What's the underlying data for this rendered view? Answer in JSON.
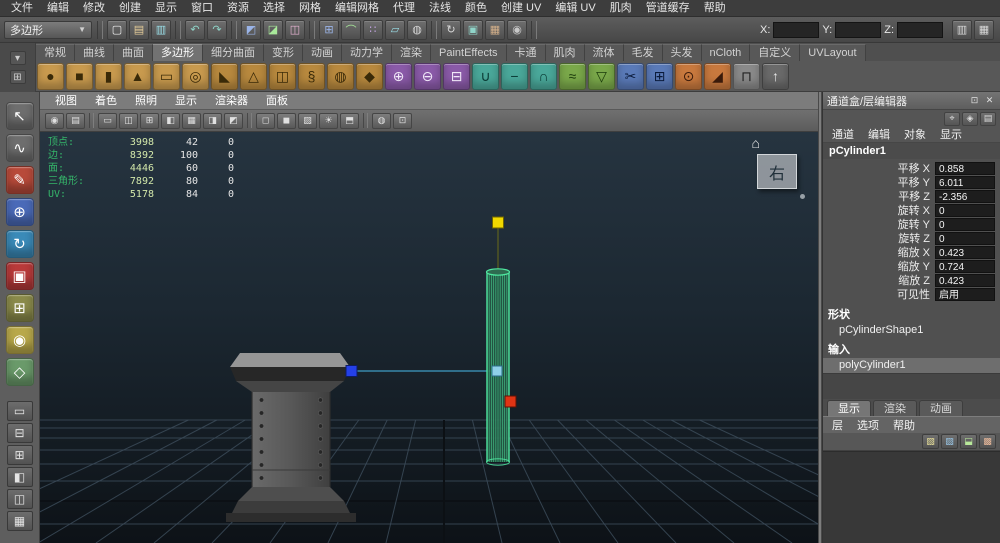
{
  "menubar": {
    "items": [
      "文件",
      "编辑",
      "修改",
      "创建",
      "显示",
      "窗口",
      "资源",
      "选择",
      "网格",
      "编辑网格",
      "代理",
      "法线",
      "颜色",
      "创建 UV",
      "编辑 UV",
      "肌肉",
      "管道缓存",
      "帮助"
    ]
  },
  "statusline": {
    "mode": "多边形",
    "dropdown_arrow": "▼",
    "icons": [
      {
        "kind": "sep",
        "name": "separator",
        "glyph": "",
        "fg": ""
      },
      {
        "kind": "btn",
        "name": "new-scene-icon",
        "glyph": "▢",
        "fg": "#f0f0f0"
      },
      {
        "kind": "btn",
        "name": "open-scene-icon",
        "glyph": "▤",
        "fg": "#e8cf9a"
      },
      {
        "kind": "btn",
        "name": "save-scene-icon",
        "glyph": "▥",
        "fg": "#9adfe8"
      },
      {
        "kind": "sep",
        "name": "separator",
        "glyph": "",
        "fg": ""
      },
      {
        "kind": "btn",
        "name": "undo-icon",
        "glyph": "↶",
        "fg": "#8fd4c8"
      },
      {
        "kind": "btn",
        "name": "redo-icon",
        "glyph": "↷",
        "fg": "#8fd4c8"
      },
      {
        "kind": "sep",
        "name": "separator",
        "glyph": "",
        "fg": ""
      },
      {
        "kind": "btn",
        "name": "select-hierarchy-mode-icon",
        "glyph": "◩",
        "fg": "#9ab4e8"
      },
      {
        "kind": "btn",
        "name": "select-object-mode-icon",
        "glyph": "◪",
        "fg": "#a8e89a"
      },
      {
        "kind": "btn",
        "name": "select-component-mode-icon",
        "glyph": "◫",
        "fg": "#e8b4d4"
      },
      {
        "kind": "sep",
        "name": "separator",
        "glyph": "",
        "fg": ""
      },
      {
        "kind": "btn",
        "name": "snap-to-grid-icon",
        "glyph": "⊞",
        "fg": "#9ab4e8"
      },
      {
        "kind": "btn",
        "name": "snap-to-curve-icon",
        "glyph": "⌒",
        "fg": "#a8e89a"
      },
      {
        "kind": "btn",
        "name": "snap-to-point-icon",
        "glyph": "∷",
        "fg": "#c8a8e8"
      },
      {
        "kind": "btn",
        "name": "snap-to-plane-icon",
        "glyph": "▱",
        "fg": "#9adfe8"
      },
      {
        "kind": "btn",
        "name": "make-live-icon",
        "glyph": "◍",
        "fg": "#d8d8d8"
      },
      {
        "kind": "sep",
        "name": "separator",
        "glyph": "",
        "fg": ""
      },
      {
        "kind": "btn",
        "name": "construction-history-icon",
        "glyph": "↻",
        "fg": "#d8d8d8"
      },
      {
        "kind": "btn",
        "name": "render-current-frame-icon",
        "glyph": "▣",
        "fg": "#8fd4c8"
      },
      {
        "kind": "btn",
        "name": "ipr-render-icon",
        "glyph": "▦",
        "fg": "#d4b08a"
      },
      {
        "kind": "btn",
        "name": "render-settings-icon",
        "glyph": "◉",
        "fg": "#c8c8c8"
      },
      {
        "kind": "sep",
        "name": "separator",
        "glyph": "",
        "fg": ""
      }
    ],
    "coords": {
      "x_label": "X:",
      "y_label": "Y:",
      "z_label": "Z:",
      "x_value": "",
      "y_value": "",
      "z_value": ""
    },
    "right_icons": [
      {
        "kind": "btn",
        "name": "toggle-channel-box-icon",
        "glyph": "▥",
        "fg": "#d8d8d8"
      },
      {
        "kind": "btn",
        "name": "toggle-tool-settings-icon",
        "glyph": "▦",
        "fg": "#d8d8d8"
      }
    ]
  },
  "shelf": {
    "side_icons": [
      {
        "name": "shelf-tab-menu-icon",
        "glyph": "▾"
      },
      {
        "name": "shelf-options-icon",
        "glyph": "⊞"
      }
    ],
    "tabs": [
      "常规",
      "曲线",
      "曲面",
      "多边形",
      "细分曲面",
      "变形",
      "动画",
      "动力学",
      "渲染",
      "PaintEffects",
      "卡通",
      "肌肉",
      "流体",
      "毛发",
      "头发",
      "nCloth",
      "自定义",
      "UVLayout"
    ],
    "active_tab": "多边形",
    "icons": [
      {
        "name": "poly-sphere-icon",
        "glyph": "●",
        "bg": "#c89a4e",
        "fg": "#3a2a08"
      },
      {
        "name": "poly-cube-icon",
        "glyph": "■",
        "bg": "#c89a4e",
        "fg": "#3a2a08"
      },
      {
        "name": "poly-cylinder-icon",
        "glyph": "▮",
        "bg": "#c89a4e",
        "fg": "#3a2a08"
      },
      {
        "name": "poly-cone-icon",
        "glyph": "▲",
        "bg": "#c89a4e",
        "fg": "#3a2a08"
      },
      {
        "name": "poly-plane-icon",
        "glyph": "▭",
        "bg": "#c89a4e",
        "fg": "#3a2a08"
      },
      {
        "name": "poly-torus-icon",
        "glyph": "◎",
        "bg": "#c89a4e",
        "fg": "#3a2a08"
      },
      {
        "name": "poly-prism-icon",
        "glyph": "◣",
        "bg": "#b8893e",
        "fg": "#3a2a08"
      },
      {
        "name": "poly-pyramid-icon",
        "glyph": "△",
        "bg": "#b8893e",
        "fg": "#3a2a08"
      },
      {
        "name": "poly-pipe-icon",
        "glyph": "◫",
        "bg": "#b8893e",
        "fg": "#3a2a08"
      },
      {
        "name": "poly-helix-icon",
        "glyph": "§",
        "bg": "#b8893e",
        "fg": "#3a2a08"
      },
      {
        "name": "poly-soccer-ball-icon",
        "glyph": "◍",
        "bg": "#b8893e",
        "fg": "#3a2a08"
      },
      {
        "name": "poly-platonic-icon",
        "glyph": "◆",
        "bg": "#b8893e",
        "fg": "#3a2a08"
      },
      {
        "name": "combine-icon",
        "glyph": "⊕",
        "bg": "#8a5aa8",
        "fg": "#f0e8f8"
      },
      {
        "name": "separate-icon",
        "glyph": "⊖",
        "bg": "#8a5aa8",
        "fg": "#f0e8f8"
      },
      {
        "name": "extract-icon",
        "glyph": "⊟",
        "bg": "#8a5aa8",
        "fg": "#f0e8f8"
      },
      {
        "name": "boolean-union-icon",
        "glyph": "∪",
        "bg": "#4aa89a",
        "fg": "#0a3a34"
      },
      {
        "name": "boolean-difference-icon",
        "glyph": "−",
        "bg": "#4aa89a",
        "fg": "#0a3a34"
      },
      {
        "name": "boolean-intersection-icon",
        "glyph": "∩",
        "bg": "#4aa89a",
        "fg": "#0a3a34"
      },
      {
        "name": "smooth-icon",
        "glyph": "≈",
        "bg": "#7aa84a",
        "fg": "#1a3a0a"
      },
      {
        "name": "reduce-icon",
        "glyph": "▽",
        "bg": "#7aa84a",
        "fg": "#1a3a0a"
      },
      {
        "name": "split-polygon-tool-icon",
        "glyph": "✂",
        "bg": "#5a7ab8",
        "fg": "#0a1a3a"
      },
      {
        "name": "append-polygon-icon",
        "glyph": "⊞",
        "bg": "#5a7ab8",
        "fg": "#0a1a3a"
      },
      {
        "name": "merge-vertices-icon",
        "glyph": "⊙",
        "bg": "#c8793e",
        "fg": "#3a1a0a"
      },
      {
        "name": "bevel-icon",
        "glyph": "◢",
        "bg": "#c8793e",
        "fg": "#3a1a0a"
      },
      {
        "name": "bridge-icon",
        "glyph": "⊓",
        "bg": "#8a8a8a",
        "fg": "#222222"
      },
      {
        "name": "extrude-icon",
        "glyph": "↑",
        "bg": "#6a6a6a",
        "fg": "#e8e8e8"
      }
    ]
  },
  "toolbox": {
    "tools": [
      {
        "name": "select-tool-icon",
        "glyph": "↖",
        "bg": "#6e6e6e",
        "fg": "#ffffff"
      },
      {
        "name": "lasso-tool-icon",
        "glyph": "∿",
        "bg": "#6e6e6e",
        "fg": "#ffffff"
      },
      {
        "name": "paint-select-tool-icon",
        "glyph": "✎",
        "bg": "#b84a3a",
        "fg": "#ffffff"
      },
      {
        "name": "move-tool-icon",
        "glyph": "⊕",
        "bg": "#4a6ab8",
        "fg": "#ffffff"
      },
      {
        "name": "rotate-tool-icon",
        "glyph": "↻",
        "bg": "#3a8ab8",
        "fg": "#ffffff"
      },
      {
        "name": "scale-tool-icon",
        "glyph": "▣",
        "bg": "#b83a3a",
        "fg": "#ffffff"
      },
      {
        "name": "universal-manipulator-icon",
        "glyph": "⊞",
        "bg": "#8a8a4a",
        "fg": "#ffffff"
      },
      {
        "name": "soft-modification-icon",
        "glyph": "◉",
        "bg": "#b8a84a",
        "fg": "#ffffff"
      },
      {
        "name": "show-manipulator-icon",
        "glyph": "◇",
        "bg": "#6a9a6a",
        "fg": "#ffffff"
      }
    ],
    "layouts": [
      {
        "name": "layout-single-pane-icon",
        "glyph": "▭"
      },
      {
        "name": "layout-two-pane-icon",
        "glyph": "⊟"
      },
      {
        "name": "layout-four-pane-icon",
        "glyph": "⊞"
      },
      {
        "name": "layout-outliner-persp-icon",
        "glyph": "◧"
      },
      {
        "name": "layout-split-vertical-icon",
        "glyph": "◫"
      },
      {
        "name": "layout-hypergraph-icon",
        "glyph": "▦"
      }
    ]
  },
  "viewport": {
    "menus": [
      "视图",
      "着色",
      "照明",
      "显示",
      "渲染器",
      "面板"
    ],
    "toolbar_icons": [
      {
        "kind": "btn",
        "name": "camera-attributes-icon",
        "glyph": "◉",
        "fg": ""
      },
      {
        "kind": "btn",
        "name": "bookmark-icon",
        "glyph": "▤",
        "fg": ""
      },
      {
        "kind": "sep",
        "name": "separator",
        "glyph": "",
        "fg": ""
      },
      {
        "kind": "btn",
        "name": "image-plane-icon",
        "glyph": "▭",
        "fg": ""
      },
      {
        "kind": "btn",
        "name": "film-gate-icon",
        "glyph": "◫",
        "fg": ""
      },
      {
        "kind": "btn",
        "name": "resolution-gate-icon",
        "glyph": "⊞",
        "fg": ""
      },
      {
        "kind": "btn",
        "name": "gate-mask-icon",
        "glyph": "◧",
        "fg": ""
      },
      {
        "kind": "btn",
        "name": "field-chart-icon",
        "glyph": "▦",
        "fg": ""
      },
      {
        "kind": "btn",
        "name": "safe-action-icon",
        "glyph": "◨",
        "fg": ""
      },
      {
        "kind": "btn",
        "name": "safe-title-icon",
        "glyph": "◩",
        "fg": ""
      },
      {
        "kind": "sep",
        "name": "separator",
        "glyph": "",
        "fg": ""
      },
      {
        "kind": "btn",
        "name": "wireframe-mode-icon",
        "glyph": "◻",
        "fg": ""
      },
      {
        "kind": "btn",
        "name": "shaded-mode-icon",
        "glyph": "◼",
        "fg": ""
      },
      {
        "kind": "btn",
        "name": "textured-mode-icon",
        "glyph": "▨",
        "fg": ""
      },
      {
        "kind": "btn",
        "name": "lights-toggle-icon",
        "glyph": "☀",
        "fg": ""
      },
      {
        "kind": "btn",
        "name": "shadows-toggle-icon",
        "glyph": "⬒",
        "fg": ""
      },
      {
        "kind": "sep",
        "name": "separator",
        "glyph": "",
        "fg": ""
      },
      {
        "kind": "btn",
        "name": "xray-mode-icon",
        "glyph": "◍",
        "fg": ""
      },
      {
        "kind": "btn",
        "name": "isolate-select-icon",
        "glyph": "⊡",
        "fg": ""
      }
    ],
    "hud": {
      "rows": [
        {
          "label": "顶点:",
          "v1": "3998",
          "v2": "42",
          "v3": "0"
        },
        {
          "label": "边:",
          "v1": "8392",
          "v2": "100",
          "v3": "0"
        },
        {
          "label": "面:",
          "v1": "4446",
          "v2": "60",
          "v3": "0"
        },
        {
          "label": "三角形:",
          "v1": "7892",
          "v2": "80",
          "v3": "0"
        },
        {
          "label": "UV:",
          "v1": "5178",
          "v2": "84",
          "v3": "0"
        }
      ]
    },
    "view_label": "右",
    "home_icon": "⌂"
  },
  "channelbox": {
    "title": "通道盒/层编辑器",
    "title_icons": [
      {
        "name": "panel-pin-icon",
        "glyph": "⊡"
      },
      {
        "name": "panel-close-icon",
        "glyph": "✕"
      }
    ],
    "toolbar_icons": [
      {
        "name": "channel-manip-icon",
        "glyph": "⌖"
      },
      {
        "name": "channel-speed-icon",
        "glyph": "◈"
      },
      {
        "name": "channel-settings-icon",
        "glyph": "▤"
      }
    ],
    "menus": [
      "通道",
      "编辑",
      "对象",
      "显示"
    ],
    "object_name": "pCylinder1",
    "attributes": [
      {
        "label": "平移 X",
        "value": "0.858"
      },
      {
        "label": "平移 Y",
        "value": "6.011"
      },
      {
        "label": "平移 Z",
        "value": "-2.356"
      },
      {
        "label": "旋转 X",
        "value": "0"
      },
      {
        "label": "旋转 Y",
        "value": "0"
      },
      {
        "label": "旋转 Z",
        "value": "0"
      },
      {
        "label": "缩放 X",
        "value": "0.423"
      },
      {
        "label": "缩放 Y",
        "value": "0.724"
      },
      {
        "label": "缩放 Z",
        "value": "0.423"
      },
      {
        "label": "可见性",
        "value": "启用"
      }
    ],
    "shapes_label": "形状",
    "shape_name": "pCylinderShape1",
    "inputs_label": "输入",
    "input_name": "polyCylinder1"
  },
  "layer_editor": {
    "tabs": [
      "显示",
      "渲染",
      "动画"
    ],
    "active_tab": "显示",
    "menus": [
      "层",
      "选项",
      "帮助"
    ],
    "icons": [
      {
        "name": "new-empty-layer-icon",
        "glyph": "▧",
        "fg": "#e8e09a"
      },
      {
        "name": "new-layer-icon",
        "glyph": "▨",
        "fg": "#9ac8e8"
      },
      {
        "name": "new-layer-from-selected-icon",
        "glyph": "⬓",
        "fg": "#b8e89a"
      },
      {
        "name": "layer-sort-icon",
        "glyph": "▩",
        "fg": "#e8b89a"
      }
    ]
  },
  "colors": {
    "selection_green": "#4fe8a0",
    "manip_yellow": "#f0d800",
    "manip_blue": "#2440e8",
    "manip_red": "#e03414",
    "manip_center": "#8fd0e8",
    "grid_line": "#3b4b59",
    "grid_axis": "#0c1014"
  }
}
